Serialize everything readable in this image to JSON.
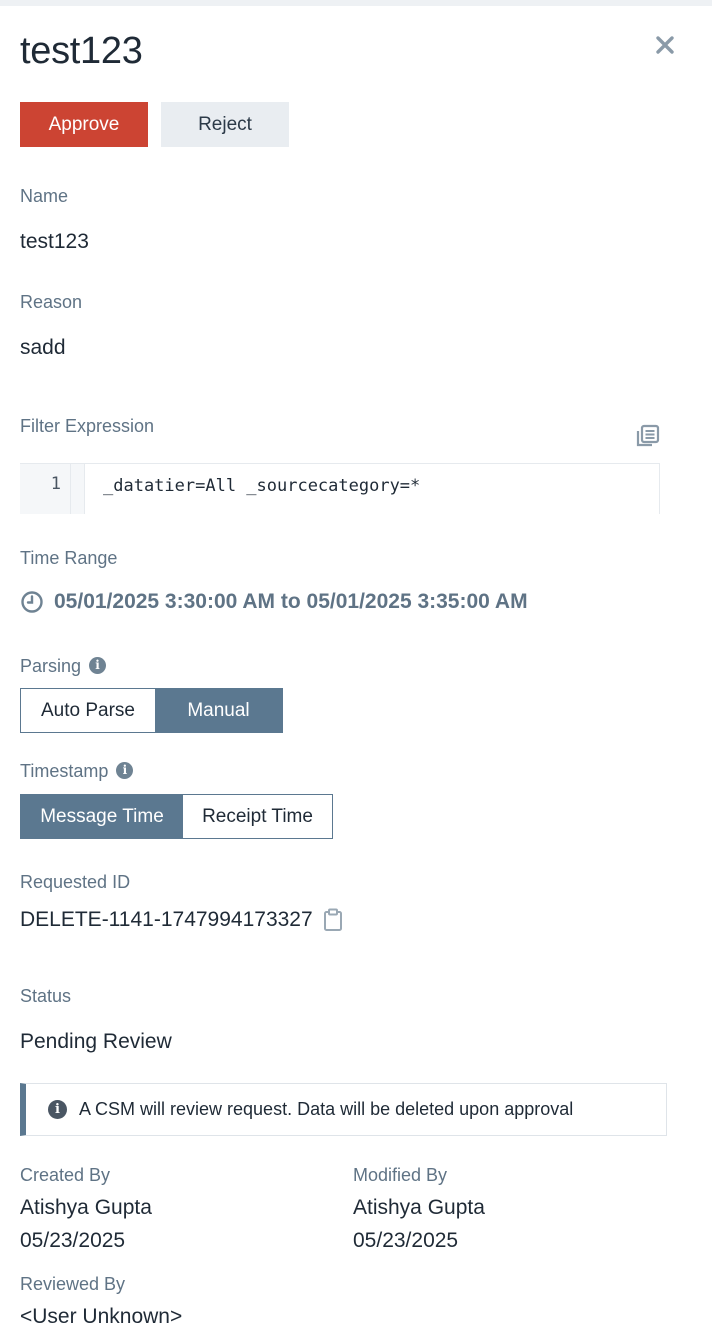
{
  "header": {
    "title": "test123",
    "close_icon": "close-icon"
  },
  "actions": {
    "approve_label": "Approve",
    "reject_label": "Reject"
  },
  "fields": {
    "name_label": "Name",
    "name_value": "test123",
    "reason_label": "Reason",
    "reason_value": "sadd",
    "filter_label": "Filter Expression",
    "filter_line_number": "1",
    "filter_value": "_datatier=All _sourcecategory=*",
    "time_range_label": "Time Range",
    "time_range_value": "05/01/2025 3:30:00 AM to 05/01/2025 3:35:00 AM",
    "parsing_label": "Parsing",
    "parsing_options": [
      "Auto Parse",
      "Manual"
    ],
    "parsing_selected": "Manual",
    "timestamp_label": "Timestamp",
    "timestamp_options": [
      "Message Time",
      "Receipt Time"
    ],
    "timestamp_selected": "Message Time",
    "requested_id_label": "Requested ID",
    "requested_id_value": "DELETE-1141-1747994173327",
    "status_label": "Status",
    "status_value": "Pending Review",
    "notice_text": "A CSM will review request. Data will be deleted upon approval",
    "created_by_label": "Created By",
    "created_by_name": "Atishya Gupta",
    "created_by_date": "05/23/2025",
    "modified_by_label": "Modified By",
    "modified_by_name": "Atishya Gupta",
    "modified_by_date": "05/23/2025",
    "reviewed_by_label": "Reviewed By",
    "reviewed_by_value": "<User Unknown>"
  },
  "colors": {
    "approve": "#cc4433",
    "accent": "#5b7890",
    "label": "#5f7385"
  }
}
